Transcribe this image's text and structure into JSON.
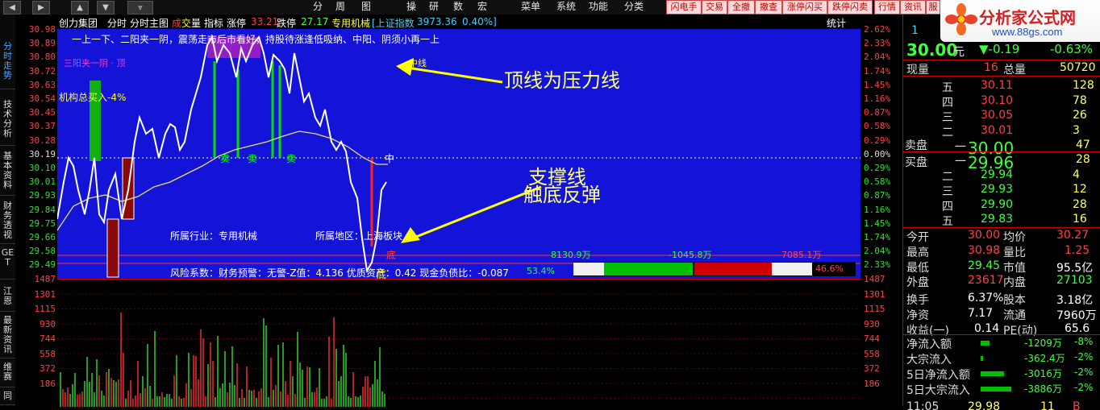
{
  "toolbar": {
    "menu": [
      "分",
      "周",
      "图",
      "操",
      "研",
      "数",
      "宏",
      "菜单",
      "系统",
      "功能",
      "分类"
    ],
    "buttons": [
      "闪电手",
      "交易",
      "全撤",
      "撤查",
      "涨停闪买",
      "跌停闪卖",
      "行情",
      "资讯",
      "服"
    ]
  },
  "brand": {
    "title": "分析家公式网",
    "url": "www.88gs.com"
  },
  "left_tabs": [
    "分时走势",
    "技术分析",
    "基本资料",
    "财务透视",
    "GET",
    "江恩",
    "最新资讯",
    "维赛",
    "同"
  ],
  "info_bar": {
    "stock": "创力集团",
    "items": [
      "分时",
      "分时主图"
    ],
    "indicator_prefix": "成",
    "indicator_mid": "交",
    "indicator_suffix": "量",
    "zhibiao": "指标",
    "limit_up_label": "涨停",
    "limit_up": "33.21",
    "limit_down_label": "跌停",
    "limit_down": "27.17",
    "sector": "专用机械",
    "index_name": "[上证指数",
    "index_value": "3973.36",
    "index_change": "0.40%]",
    "stat_label": "统计"
  },
  "price_axis": {
    "left": [
      "30.98",
      "30.89",
      "30.80",
      "30.72",
      "30.63",
      "30.54",
      "30.45",
      "30.37",
      "30.28",
      "30.19",
      "30.10",
      "30.01",
      "29.93",
      "29.84",
      "29.75",
      "29.66",
      "29.58",
      "29.49"
    ],
    "right": [
      "2.62%",
      "2.33%",
      "2.04%",
      "1.74%",
      "1.45%",
      "1.16%",
      "0.87%",
      "0.58%",
      "0.29%",
      "0.00%",
      "0.29%",
      "0.58%",
      "0.87%",
      "1.16%",
      "1.45%",
      "1.74%",
      "2.04%",
      "2.33%"
    ]
  },
  "volume_axis": [
    "1487",
    "1301",
    "1115",
    "930",
    "744",
    "558",
    "372",
    "186"
  ],
  "chart_texts": {
    "line1": "一上一下、二阳夹一阴，震荡走市后市看好，持股待涨逢低吸纳、中阳、阴须小再一上",
    "line2": "三阳夹一阴 · 顶",
    "line2_suffix": "中线",
    "org_buy": "机构总买入-4%",
    "sell": "卖",
    "mid": "中",
    "bottom": "底",
    "bottom2": "底",
    "industry_label": "所属行业：",
    "industry": "专用机械",
    "region_label": "所属地区：",
    "region": "上海板块",
    "risk": "风险系数：财务预警：无警-Z值：4.136 优质资产：0.42 现金负债比：-0.087",
    "pct_left": "53.4%",
    "pct_right": "46.6%",
    "bar_v1": "8130.9万",
    "bar_v2": "-1045.8万",
    "bar_v3": "7085.1万"
  },
  "annotations": {
    "top": "顶线为压力线",
    "support1": "支撑线",
    "support2": "触底反弹"
  },
  "quote": {
    "code_text": "1",
    "price": "30.00",
    "unit": "元",
    "change": "▼-0.19",
    "change_pct": "-0.63%",
    "xianliang_label": "现量",
    "xianliang": "16",
    "zongliang_label": "总量",
    "zongliang": "50720",
    "sell_label": "卖盘",
    "buy_label": "买盘",
    "asks": [
      {
        "lv": "五",
        "price": "30.11",
        "vol": "128"
      },
      {
        "lv": "四",
        "price": "30.10",
        "vol": "78"
      },
      {
        "lv": "三",
        "price": "30.05",
        "vol": "26"
      },
      {
        "lv": "二",
        "price": "30.01",
        "vol": "3"
      },
      {
        "lv": "一",
        "price": "30.00",
        "vol": "47"
      }
    ],
    "bids": [
      {
        "lv": "一",
        "price": "29.96",
        "vol": "28"
      },
      {
        "lv": "二",
        "price": "29.94",
        "vol": "4"
      },
      {
        "lv": "三",
        "price": "29.93",
        "vol": "12"
      },
      {
        "lv": "四",
        "price": "29.90",
        "vol": "28"
      },
      {
        "lv": "五",
        "price": "29.83",
        "vol": "16"
      }
    ],
    "stats": [
      [
        "今开",
        "30.00",
        "均价",
        "30.27"
      ],
      [
        "最高",
        "30.98",
        "量比",
        "1.25"
      ],
      [
        "最低",
        "29.45",
        "市值",
        "95.5亿"
      ],
      [
        "外盘",
        "23617",
        "内盘",
        "27103"
      ],
      [
        "换手",
        "6.37%",
        "股本",
        "3.18亿"
      ],
      [
        "净资",
        "7.17",
        "流通",
        "7960万"
      ],
      [
        "收益(一)",
        "0.14",
        "PE(动)",
        "65.6"
      ]
    ],
    "flows": [
      {
        "label": "净流入额",
        "value": "-1209万",
        "pct": "-8%",
        "bar": 0.25
      },
      {
        "label": "大宗流入",
        "value": "-362.4万",
        "pct": "-2%",
        "bar": 0.08
      },
      {
        "label": "5日净流入额",
        "value": "-3016万",
        "pct": "-2%",
        "bar": 0.7
      },
      {
        "label": "5日大宗流入",
        "value": "-3886万",
        "pct": "-2%",
        "bar": 0.9
      }
    ],
    "footer": [
      "11:05",
      "29.98",
      "11",
      "B"
    ]
  },
  "colors": {
    "panel_blue": "#1414d8",
    "up": "#ff3030",
    "down": "#00d800",
    "yellow": "#ffff00"
  }
}
